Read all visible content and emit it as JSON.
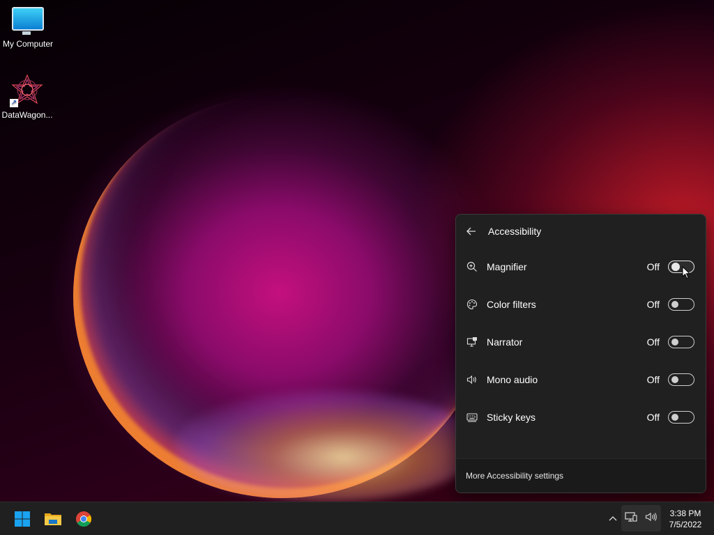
{
  "desktop": {
    "icons": [
      {
        "label": "My Computer",
        "icon": "monitor-icon"
      },
      {
        "label": "DataWagon...",
        "icon": "datawagon-icon"
      }
    ]
  },
  "panel": {
    "title": "Accessibility",
    "back_icon": "back-arrow-icon",
    "rows": [
      {
        "label": "Magnifier",
        "state": "Off",
        "icon": "magnifier-icon",
        "on": false
      },
      {
        "label": "Color filters",
        "state": "Off",
        "icon": "palette-icon",
        "on": false
      },
      {
        "label": "Narrator",
        "state": "Off",
        "icon": "narrator-icon",
        "on": false
      },
      {
        "label": "Mono audio",
        "state": "Off",
        "icon": "speaker-icon",
        "on": false
      },
      {
        "label": "Sticky keys",
        "state": "Off",
        "icon": "keyboard-icon",
        "on": false
      }
    ],
    "footer_link": "More Accessibility settings"
  },
  "taskbar": {
    "apps": [
      {
        "name": "start-button",
        "icon": "windows-icon"
      },
      {
        "name": "file-explorer-button",
        "icon": "folder-icon"
      },
      {
        "name": "chrome-button",
        "icon": "chrome-icon"
      }
    ],
    "tray": {
      "chevron_icon": "chevron-up-icon",
      "network_icon": "network-icon",
      "volume_icon": "volume-icon"
    },
    "clock": {
      "time": "3:38 PM",
      "date": "7/5/2022"
    }
  },
  "colors": {
    "panel_bg": "#202020",
    "taskbar_bg": "#202020",
    "accent": "#0078d4"
  }
}
